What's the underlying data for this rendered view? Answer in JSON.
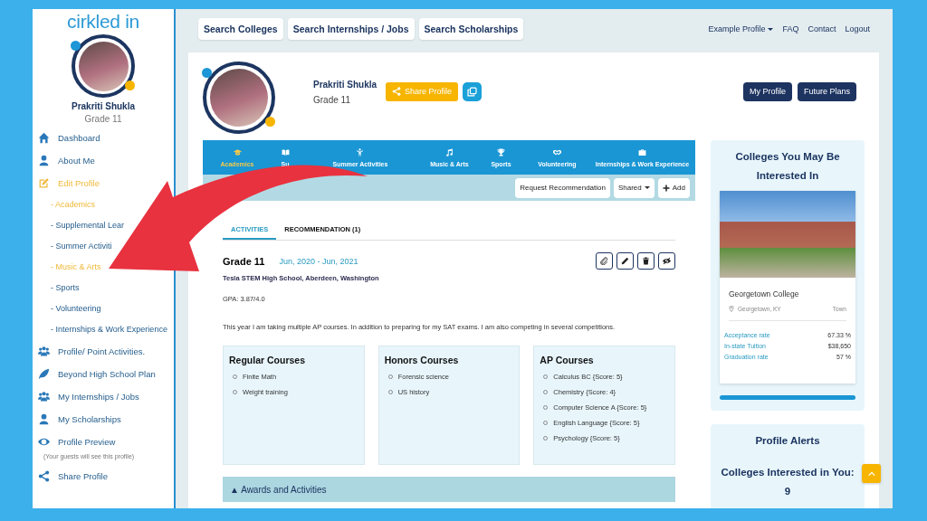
{
  "logo": {
    "text": "cirkled in"
  },
  "sidebar": {
    "name": "Prakriti Shukla",
    "grade": "Grade 11",
    "items": [
      {
        "label": "Dashboard",
        "active": false
      },
      {
        "label": "About Me",
        "active": false
      },
      {
        "label": "Edit Profile",
        "active": true,
        "children": [
          {
            "label": "- Academics",
            "active": true
          },
          {
            "label": "- Supplemental Lear",
            "active": false
          },
          {
            "label": "- Summer Activiti",
            "active": false
          },
          {
            "label": "- Music & Arts",
            "active": true
          },
          {
            "label": "- Sports",
            "active": false
          },
          {
            "label": "- Volunteering",
            "active": false
          },
          {
            "label": "- Internships & Work Experience",
            "active": false
          }
        ]
      },
      {
        "label": "Profile/ Point Activities.",
        "active": false
      },
      {
        "label": "Beyond High School Plan",
        "active": false
      },
      {
        "label": "My Internships / Jobs",
        "active": false
      },
      {
        "label": "My Scholarships",
        "active": false
      },
      {
        "label": "Profile Preview",
        "active": false,
        "note": "(Your guests will see this profile)"
      },
      {
        "label": "Share Profile",
        "active": false
      }
    ]
  },
  "top_nav": {
    "search_buttons": [
      "Search Colleges",
      "Search Internships / Jobs",
      "Search Scholarships"
    ],
    "links": [
      {
        "label": "Example Profile",
        "dropdown": true
      },
      {
        "label": "FAQ",
        "dropdown": false
      },
      {
        "label": "Contact",
        "dropdown": false
      },
      {
        "label": "Logout",
        "dropdown": false
      }
    ]
  },
  "profile": {
    "name": "Prakriti Shukla",
    "grade": "Grade 11",
    "share_button": "Share Profile",
    "buttons": [
      "My Profile",
      "Future Plans"
    ]
  },
  "category_tabs": [
    {
      "label": "Academics",
      "selected": true
    },
    {
      "label": "Su",
      "selected": false
    },
    {
      "label": "Summer Activities",
      "selected": false
    },
    {
      "label": "Music & Arts",
      "selected": false
    },
    {
      "label": "Sports",
      "selected": false
    },
    {
      "label": "Volunteering",
      "selected": false
    },
    {
      "label": "Internships & Work Experience",
      "selected": false
    }
  ],
  "toolbar": {
    "request_button": "Request Recommendation",
    "shared_dropdown": "Shared",
    "add_button": "Add"
  },
  "sub_tabs": [
    {
      "label": "ACTIVITIES",
      "selected": true
    },
    {
      "label": "RECOMMENDATION (1)",
      "selected": false
    }
  ],
  "entry": {
    "title": "Grade 11",
    "dates": "Jun, 2020 - Jun, 2021",
    "school": "Tesla STEM High School, Aberdeen, Washington",
    "gpa": "GPA: 3.87/4.0",
    "description": "This year I am taking multiple AP courses. In addition to preparing for my SAT exams. I am also competing in several competitions.",
    "course_groups": [
      {
        "title": "Regular Courses",
        "items": [
          "Finite Math",
          "Weight training"
        ]
      },
      {
        "title": "Honors Courses",
        "items": [
          "Forensic science",
          "US history"
        ]
      },
      {
        "title": "AP Courses",
        "items": [
          "Calculus BC {Score: 5}",
          "Chemistry {Score: 4}",
          "Computer Science A {Score: 5}",
          "English Language {Score: 5}",
          "Psychology {Score: 5}"
        ]
      }
    ],
    "awards": {
      "toggle": "▲",
      "label": "Awards and Activities"
    }
  },
  "colleges_panel": {
    "title": "Colleges You May Be Interested In",
    "college": {
      "name": "Georgetown College",
      "location": "Georgetown, KY",
      "setting": "Town",
      "stats": [
        {
          "label": "Acceptance rate",
          "value": "67.33 %"
        },
        {
          "label": "In-state Tuition",
          "value": "$38,650"
        },
        {
          "label": "Graduation rate",
          "value": "57 %"
        }
      ]
    }
  },
  "alerts_panel": {
    "title": "Profile Alerts",
    "text": "Colleges Interested in You: 9"
  }
}
